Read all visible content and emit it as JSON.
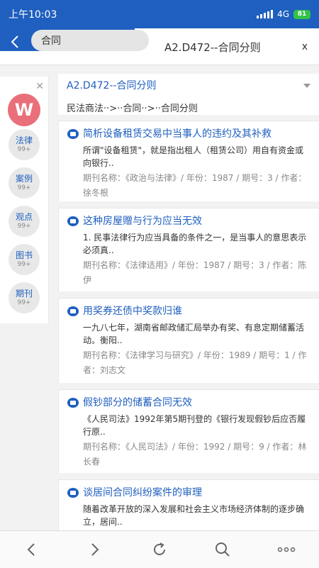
{
  "status_bar": {
    "time": "上午10:03",
    "network": "4G",
    "battery": "81"
  },
  "header": {
    "search_value": "合同",
    "title": "A2.D472--合同分则",
    "close_label": "x"
  },
  "sidebar": {
    "logo_text": "W",
    "items": [
      {
        "label": "法律",
        "count": "99+"
      },
      {
        "label": "案例",
        "count": "99+"
      },
      {
        "label": "观点",
        "count": "99+"
      },
      {
        "label": "图书",
        "count": "99+"
      },
      {
        "label": "期刊",
        "count": "99+"
      }
    ]
  },
  "category": {
    "title": "A2.D472--合同分则",
    "path": "民法商法··>··合同··>··合同分则"
  },
  "results": [
    {
      "title": "简析设备租赁交易中当事人的违约及其补救",
      "abstract": "所谓\"设备租赁\"，就是指出租人（租赁公司）用自有资金或向银行..",
      "meta": "期刊名称：《政治与法律》/ 年份：1987 / 期号：3 / 作者：徐冬根"
    },
    {
      "title": "这种房屋赠与行为应当无效",
      "abstract": "1. 民事法律行为应当具备的条件之一，是当事人的意思表示必须真..",
      "meta": "期刊名称：《法律适用》/ 年份：1987 / 期号：3 / 作者：陈伊"
    },
    {
      "title": "用奖券还债中奖款归谁",
      "abstract": "一九八七年，湖南省邮政储汇局举办有奖、有息定期储蓄活动。衡阳..",
      "meta": "期刊名称：《法律学习与研究》/ 年份：1989 / 期号：1 / 作者：刘志文"
    },
    {
      "title": "假钞部分的储蓄合同无效",
      "abstract": "《人民司法》1992年第5期刊登的《银行发现假钞后应否履行原..",
      "meta": "期刊名称：《人民司法》/ 年份：1992 / 期号：9 / 作者：林长春"
    },
    {
      "title": "谈居间合同纠纷案件的审理",
      "abstract": "随着改革开放的深入发展和社会主义市场经济体制的逐步确立，居间..",
      "meta": ""
    }
  ],
  "colors": {
    "accent": "#1f5fbf",
    "logo_bg": "#e9707a",
    "battery": "#33c24a"
  },
  "bottom_nav": [
    "chevron-left-icon",
    "chevron-right-icon",
    "refresh-icon",
    "search-icon",
    "more-icon"
  ]
}
